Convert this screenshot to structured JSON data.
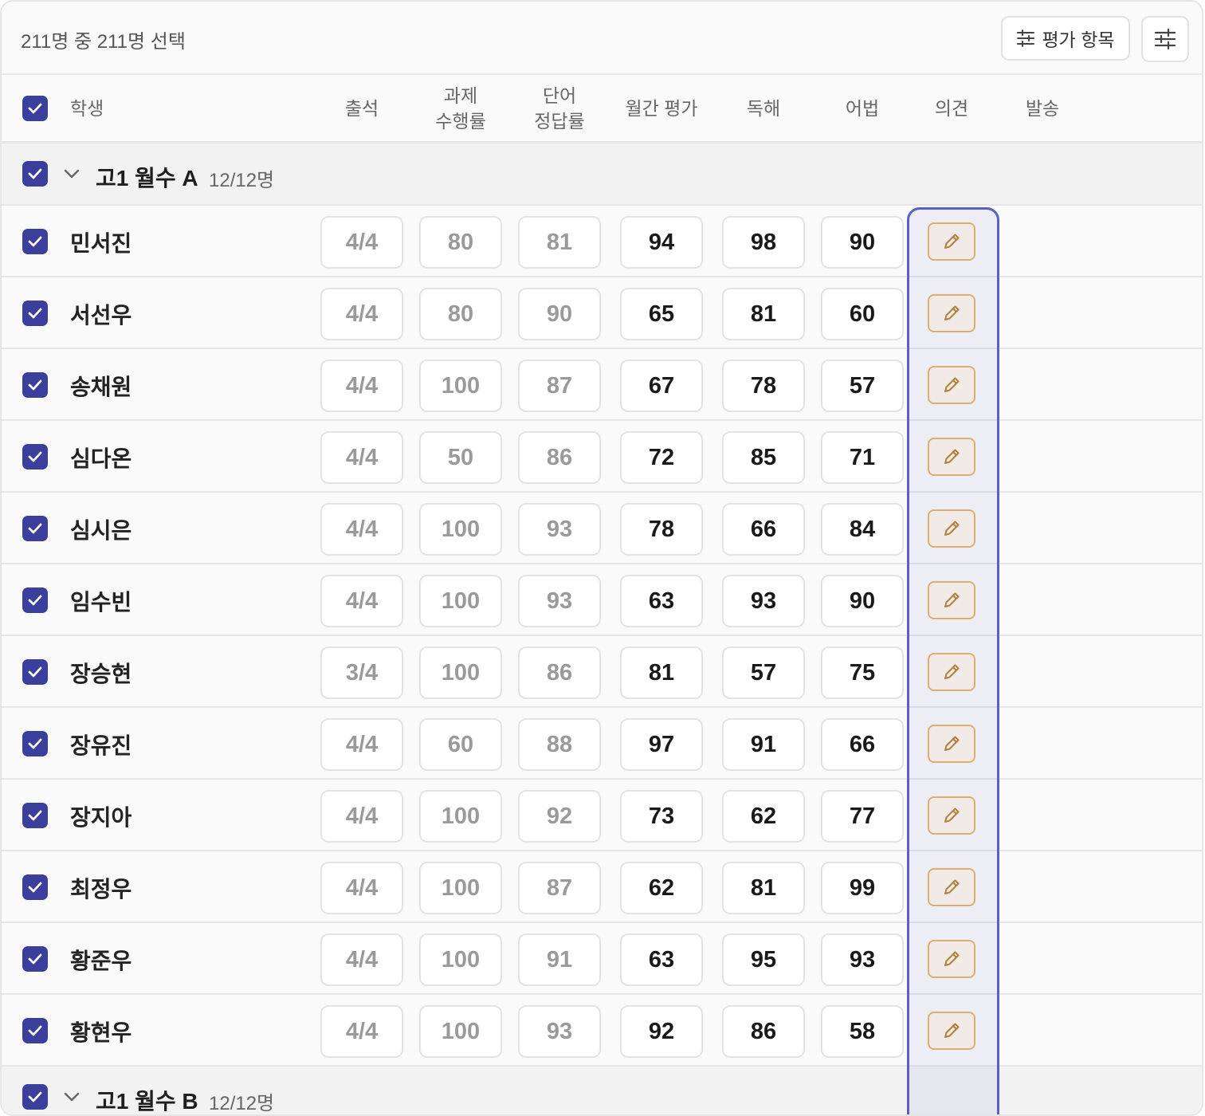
{
  "selection": {
    "text": "211명 중 211명 선택"
  },
  "toolbar": {
    "criteria_label": "평가 항목"
  },
  "columns": {
    "student": "학생",
    "attendance": "출석",
    "assignment": "과제\n수행률",
    "vocab": "단어\n정답률",
    "monthly": "월간 평가",
    "reading": "독해",
    "grammar": "어법",
    "opinion": "의견",
    "send": "발송"
  },
  "groups": [
    {
      "title": "고1 월수 A",
      "count": "12/12명",
      "students": [
        {
          "name": "민서진",
          "attendance": "4/4",
          "assignment": "80",
          "vocab": "81",
          "monthly": "94",
          "reading": "98",
          "grammar": "90"
        },
        {
          "name": "서선우",
          "attendance": "4/4",
          "assignment": "80",
          "vocab": "90",
          "monthly": "65",
          "reading": "81",
          "grammar": "60"
        },
        {
          "name": "송채원",
          "attendance": "4/4",
          "assignment": "100",
          "vocab": "87",
          "monthly": "67",
          "reading": "78",
          "grammar": "57"
        },
        {
          "name": "심다온",
          "attendance": "4/4",
          "assignment": "50",
          "vocab": "86",
          "monthly": "72",
          "reading": "85",
          "grammar": "71"
        },
        {
          "name": "심시은",
          "attendance": "4/4",
          "assignment": "100",
          "vocab": "93",
          "monthly": "78",
          "reading": "66",
          "grammar": "84"
        },
        {
          "name": "임수빈",
          "attendance": "4/4",
          "assignment": "100",
          "vocab": "93",
          "monthly": "63",
          "reading": "93",
          "grammar": "90"
        },
        {
          "name": "장승현",
          "attendance": "3/4",
          "assignment": "100",
          "vocab": "86",
          "monthly": "81",
          "reading": "57",
          "grammar": "75"
        },
        {
          "name": "장유진",
          "attendance": "4/4",
          "assignment": "60",
          "vocab": "88",
          "monthly": "97",
          "reading": "91",
          "grammar": "66"
        },
        {
          "name": "장지아",
          "attendance": "4/4",
          "assignment": "100",
          "vocab": "92",
          "monthly": "73",
          "reading": "62",
          "grammar": "77"
        },
        {
          "name": "최정우",
          "attendance": "4/4",
          "assignment": "100",
          "vocab": "87",
          "monthly": "62",
          "reading": "81",
          "grammar": "99"
        },
        {
          "name": "황준우",
          "attendance": "4/4",
          "assignment": "100",
          "vocab": "91",
          "monthly": "63",
          "reading": "95",
          "grammar": "93"
        },
        {
          "name": "황현우",
          "attendance": "4/4",
          "assignment": "100",
          "vocab": "93",
          "monthly": "92",
          "reading": "86",
          "grammar": "58"
        }
      ]
    },
    {
      "title": "고1 월수 B",
      "count": "12/12명",
      "students": []
    }
  ],
  "colors": {
    "accent": "#3b3f9c",
    "highlight": "#5b5fc7",
    "edit_border": "#e6b766",
    "edit_icon": "#b8862e"
  },
  "icons": {
    "criteria": "sliders-icon",
    "settings": "sliders-icon",
    "edit": "pencil-icon",
    "check": "check-icon",
    "collapse": "chevron-down-icon"
  }
}
